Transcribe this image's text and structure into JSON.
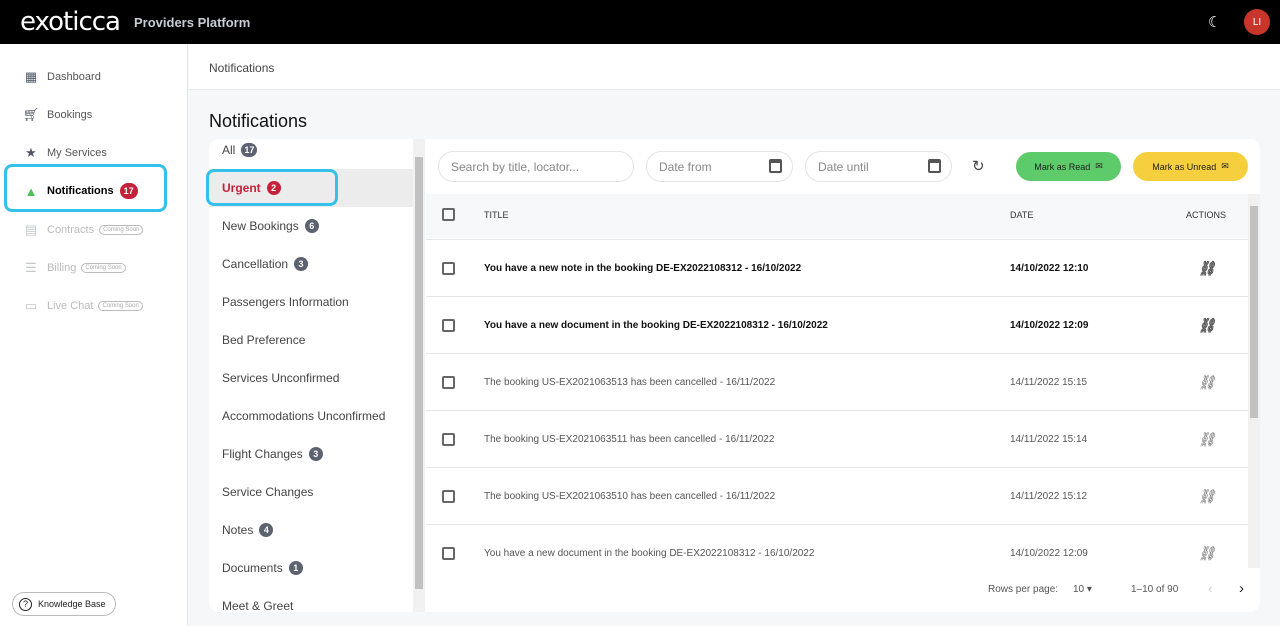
{
  "header": {
    "logo": "exoticca",
    "title": "Providers Platform",
    "avatar": "LI"
  },
  "sidebar": {
    "items": [
      {
        "label": "Dashboard",
        "icon": "dashboard-icon"
      },
      {
        "label": "Bookings",
        "icon": "cart-icon"
      },
      {
        "label": "My Services",
        "icon": "star-icon"
      },
      {
        "label": "Notifications",
        "icon": "bell-icon",
        "badge": "17"
      },
      {
        "label": "Contracts",
        "icon": "document-icon",
        "soon": "Coming Soon"
      },
      {
        "label": "Billing",
        "icon": "list-icon",
        "soon": "Coming Soon"
      },
      {
        "label": "Live Chat",
        "icon": "chat-icon",
        "soon": "Coming Soon"
      }
    ],
    "knowledge_base": "Knowledge Base"
  },
  "breadcrumb": "Notifications",
  "page_title": "Notifications",
  "categories": [
    {
      "label": "All",
      "badge": "17"
    },
    {
      "label": "Urgent",
      "badge": "2"
    },
    {
      "label": "New Bookings",
      "badge": "6"
    },
    {
      "label": "Cancellation",
      "badge": "3"
    },
    {
      "label": "Passengers Information"
    },
    {
      "label": "Bed Preference"
    },
    {
      "label": "Services Unconfirmed"
    },
    {
      "label": "Accommodations Unconfirmed"
    },
    {
      "label": "Flight Changes",
      "badge": "3"
    },
    {
      "label": "Service Changes"
    },
    {
      "label": "Notes",
      "badge": "4"
    },
    {
      "label": "Documents",
      "badge": "1"
    },
    {
      "label": "Meet & Greet"
    }
  ],
  "filters": {
    "search_placeholder": "Search by title, locator...",
    "date_from": "Date from",
    "date_until": "Date until",
    "mark_read": "Mark as Read",
    "mark_unread": "Mark as Unread"
  },
  "colors": {
    "read": "#5ecb6b",
    "unread": "#f5cf3e",
    "accent": "#c4223a",
    "highlight": "#33c0ea"
  },
  "table": {
    "columns": [
      "TITLE",
      "DATE",
      "ACTIONS"
    ],
    "rows": [
      {
        "title": "You have a new note in the booking DE-EX2022108312 - 16/10/2022",
        "date": "14/10/2022 12:10",
        "unread": true
      },
      {
        "title": "You have a new document in the booking DE-EX2022108312 - 16/10/2022",
        "date": "14/10/2022 12:09",
        "unread": true
      },
      {
        "title": "The booking US-EX2021063513 has been cancelled - 16/11/2022",
        "date": "14/11/2022 15:15"
      },
      {
        "title": "The booking US-EX2021063511 has been cancelled - 16/11/2022",
        "date": "14/11/2022 15:14"
      },
      {
        "title": "The booking US-EX2021063510 has been cancelled - 16/11/2022",
        "date": "14/11/2022 15:12"
      },
      {
        "title": "You have a new document in the booking DE-EX2022108312 - 16/10/2022",
        "date": "14/10/2022 12:09"
      }
    ]
  },
  "pagination": {
    "rows_label": "Rows per page:",
    "rows_value": "10",
    "range": "1–10 of 90"
  }
}
